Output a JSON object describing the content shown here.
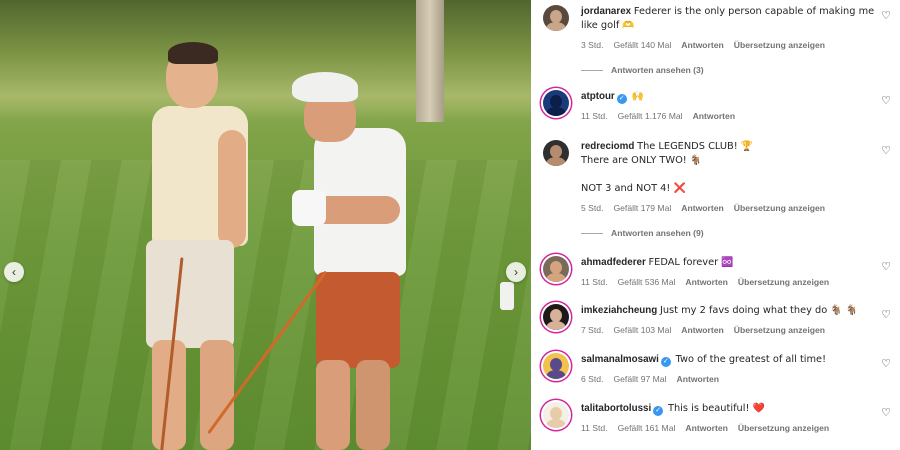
{
  "photo": {
    "prev_icon": "chevron-left-icon",
    "next_icon": "chevron-right-icon",
    "prev_glyph": "‹",
    "next_glyph": "›"
  },
  "comments": [
    {
      "user": "jordanarex",
      "verified": false,
      "text": "Federer is the only person capable of making me like golf 🫶",
      "time": "3 Std.",
      "likes": "Gefällt 140 Mal",
      "reply": "Antworten",
      "translate": "Übersetzung anzeigen",
      "avatar_colors": [
        "#c9a58a",
        "#5a4a3e"
      ],
      "story_ring": false
    },
    {
      "user": "atptour",
      "verified": true,
      "text": "🙌",
      "time": "11 Std.",
      "likes": "Gefällt 1.176 Mal",
      "reply": "Antworten",
      "translate": "",
      "avatar_colors": [
        "#0b1f4a",
        "#1a3a7a"
      ],
      "story_ring": true
    },
    {
      "user": "redreciomd",
      "verified": false,
      "text": "The LEGENDS CLUB! 🏆\nThere are ONLY TWO! 🐐\n\nNOT 3 and NOT 4! ❌",
      "time": "5 Std.",
      "likes": "Gefällt 179 Mal",
      "reply": "Antworten",
      "translate": "Übersetzung anzeigen",
      "avatar_colors": [
        "#b58c6e",
        "#2f2f2f"
      ],
      "story_ring": false
    },
    {
      "user": "ahmadfederer",
      "verified": false,
      "text": "FEDAL forever ♾️",
      "time": "11 Std.",
      "likes": "Gefällt 536 Mal",
      "reply": "Antworten",
      "translate": "Übersetzung anzeigen",
      "avatar_colors": [
        "#d3a47f",
        "#7a6a5a"
      ],
      "story_ring": true
    },
    {
      "user": "imkeziahcheung",
      "verified": false,
      "text": "Just my 2 favs doing what they do 🐐 🐐",
      "time": "7 Std.",
      "likes": "Gefällt 103 Mal",
      "reply": "Antworten",
      "translate": "Übersetzung anzeigen",
      "avatar_colors": [
        "#d8b19a",
        "#1f1a1a"
      ],
      "story_ring": true
    },
    {
      "user": "salmanalmosawi",
      "verified": true,
      "text": "Two of the greatest of all time!",
      "time": "6 Std.",
      "likes": "Gefällt 97 Mal",
      "reply": "Antworten",
      "translate": "",
      "avatar_colors": [
        "#5a4a8a",
        "#f2c14e"
      ],
      "story_ring": true
    },
    {
      "user": "talitabortolussi",
      "verified": true,
      "text": "This is beautiful! ❤️",
      "time": "11 Std.",
      "likes": "Gefällt 161 Mal",
      "reply": "Antworten",
      "translate": "Übersetzung anzeigen",
      "avatar_colors": [
        "#e8cba8",
        "#f5f0e6"
      ],
      "story_ring": true
    }
  ],
  "view_replies": [
    {
      "label": "Antworten ansehen (3)"
    },
    {
      "label": "Antworten ansehen (9)"
    }
  ],
  "icons": {
    "like": "heart-outline-icon",
    "like_glyph": "♡",
    "verified": "verified-badge-icon",
    "verified_glyph": "✓"
  }
}
